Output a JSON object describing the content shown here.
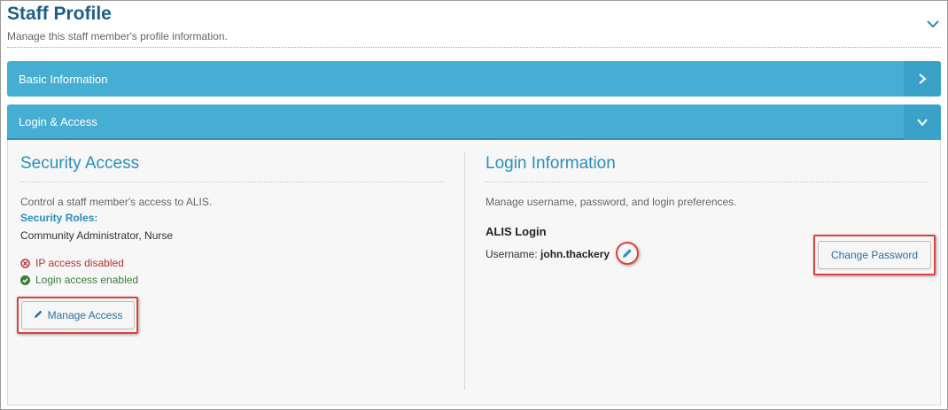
{
  "header": {
    "title": "Staff Profile",
    "subtitle": "Manage this staff member's profile information."
  },
  "panels": {
    "basic": {
      "label": "Basic Information"
    },
    "login": {
      "label": "Login & Access"
    }
  },
  "security": {
    "title": "Security Access",
    "description": "Control a staff member's access to ALIS.",
    "roles_label": "Security Roles:",
    "roles_value": "Community Administrator, Nurse",
    "status_ip": "IP access disabled",
    "status_login": "Login access enabled",
    "manage_button": "Manage Access"
  },
  "login_info": {
    "title": "Login Information",
    "description": "Manage username, password, and login preferences.",
    "subheading": "ALIS Login",
    "username_label": "Username:",
    "username_value": "john.thackery",
    "change_password_button": "Change Password"
  },
  "colors": {
    "panel_header": "#47aed3",
    "title_blue": "#1d5f8a",
    "section_blue": "#2b8fc0",
    "status_red": "#b8312f",
    "status_green": "#3f7d3b",
    "highlight_red": "#e0413b"
  },
  "icons": {
    "collapse": "chevron-down-icon",
    "basic_panel": "chevron-right-icon",
    "login_panel": "chevron-down-icon",
    "ip_status": "x-circle-icon",
    "login_status": "check-circle-icon",
    "manage": "pencil-icon",
    "edit_username": "pencil-icon"
  }
}
